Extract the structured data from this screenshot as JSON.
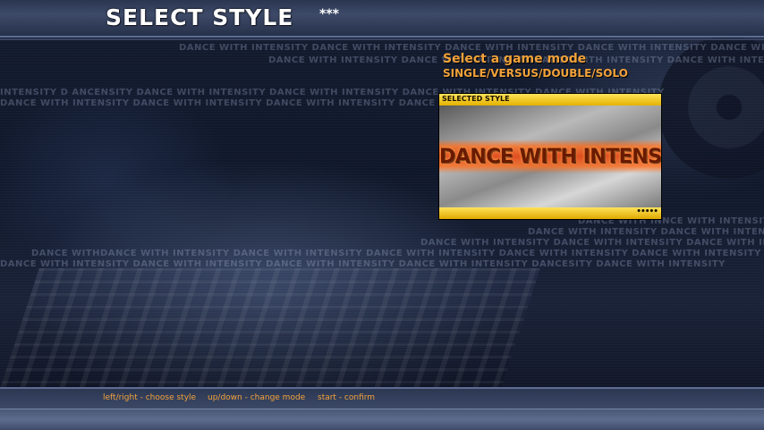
{
  "screen": {
    "title": "SELECT STYLE",
    "title_decoration": "***"
  },
  "mode": {
    "heading": "Select a game mode",
    "options": "SINGLE/VERSUS/DOUBLE/SOLO"
  },
  "selected_style": {
    "label": "SELECTED STYLE",
    "logo_text": "DANCE WITH INTENSITY",
    "indicator": "•••••"
  },
  "background_text": {
    "row_1": "DANCE WITH INTENSITY DANCE WITH INTENSITY DANCE WITH INTENSITY DANCE WITH INTENSITY DANCE WITH INTENSITY",
    "row_2": "DANCE WITH INTENSITY DANCE WITH INTENSITY DANCE WITH INTENSITY DANCE WITH INTENSITY DANCE WITH INTENSITY",
    "row_3": "INTENSITY D ANCENSITY DANCE WITH INTENSITY DANCE WITH INTENSITY DANCE WITH INTENSITY DANCE WITH INTENSITY",
    "row_4": "DANCE WITH INTENSITY DANCE WITH INTENSITY DANCE WITH INTENSITY DANCE WITH INTENSITY DANCE WITH INTENSITY",
    "row_5": "DANCE WITH INNCE WITH INTENSITY DANCE WITH INTENSITY",
    "row_6": "DANCE WITH INTENSITY DANCE WITH INTENSITY",
    "row_7": "DANCE WITH INTENSITY DANCE WITH INTENSITY DANCE WITH INTENSITY DANCE WITH INTENSITY DANCE WITH INTENSITY",
    "row_8": "DANCE WITHDANCE WITH INTENSITY DANCE WITH INTENSITY DANCE WITH INTENSITY DANCE WITH INTENSITY DANCE WITH INTENSITY H INTENSITY",
    "row_9": "DANCE WITH INTENSITY DANCE WITH INTENSITY DANCE WITH INTENSITY DANCE WITH INTENSITY DANCESITY DANCE WITH INTENSITY"
  },
  "controls": {
    "left_right": "left/right - choose style",
    "up_down": "up/down - change mode",
    "start": "start - confirm"
  },
  "colors": {
    "accent_orange": "#f2a23a",
    "panel_yellow": "#ffe35a",
    "bar_blue": "#3d4a68"
  }
}
